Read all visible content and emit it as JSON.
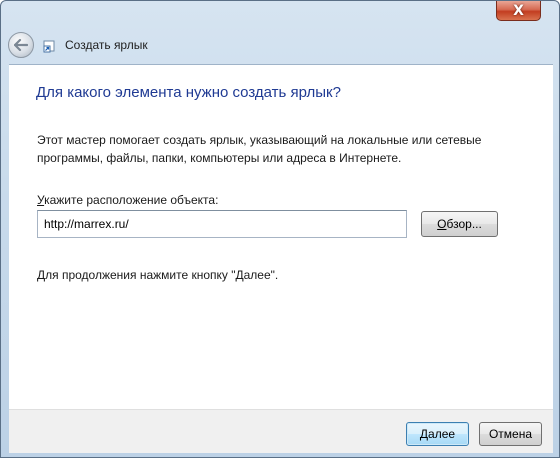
{
  "window": {
    "title": "Создать ярлык",
    "close_symbol": "X"
  },
  "icons": {
    "back": "back-arrow-icon",
    "shortcut": "shortcut-icon",
    "close": "close-icon"
  },
  "main": {
    "heading": "Для какого элемента нужно создать ярлык?",
    "description": "Этот мастер помогает создать ярлык, указывающий на локальные или сетевые программы, файлы, папки, компьютеры или адреса в Интернете.",
    "location_label_access": "У",
    "location_label_rest": "кажите расположение объекта:",
    "location_value": "http://marrex.ru/",
    "browse_access": "О",
    "browse_rest": "бзор...",
    "hint": "Для продолжения нажмите кнопку \"Далее\"."
  },
  "footer": {
    "next_label": "Далее",
    "cancel_label": "Отмена"
  },
  "colors": {
    "heading": "#1f3a93",
    "close_button": "#c23d20",
    "default_button_border": "#3c7fb1"
  }
}
